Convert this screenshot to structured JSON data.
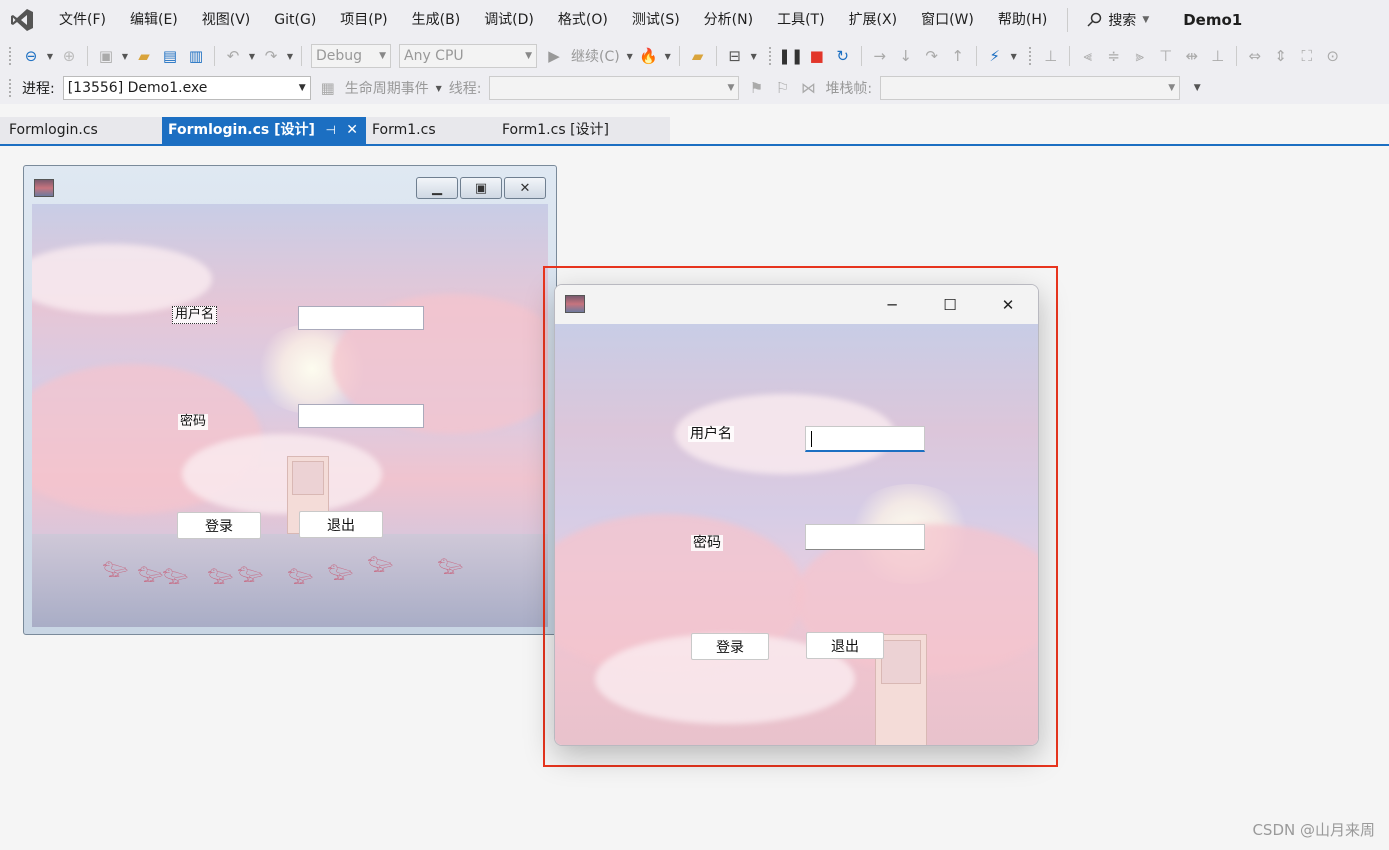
{
  "menubar": {
    "items": [
      "文件(F)",
      "编辑(E)",
      "视图(V)",
      "Git(G)",
      "项目(P)",
      "生成(B)",
      "调试(D)",
      "格式(O)",
      "测试(S)",
      "分析(N)",
      "工具(T)",
      "扩展(X)",
      "窗口(W)",
      "帮助(H)"
    ],
    "search_label": "搜索",
    "solution_name": "Demo1"
  },
  "toolbar": {
    "config": "Debug",
    "platform": "Any CPU",
    "continue_label": "继续(C)",
    "process_label": "进程:",
    "process_value": "[13556] Demo1.exe",
    "lifecycle_label": "生命周期事件",
    "thread_label": "线程:",
    "stackframe_label": "堆栈帧:"
  },
  "tabs": [
    {
      "label": "Formlogin.cs",
      "active": false
    },
    {
      "label": "Formlogin.cs [设计]",
      "active": true
    },
    {
      "label": "Form1.cs",
      "active": false
    },
    {
      "label": "Form1.cs [设计]",
      "active": false
    }
  ],
  "designer_form": {
    "username_label": "用户名",
    "password_label": "密码",
    "login_button": "登录",
    "exit_button": "退出"
  },
  "running_form": {
    "username_label": "用户名",
    "password_label": "密码",
    "login_button": "登录",
    "exit_button": "退出"
  },
  "watermark": "CSDN @山月来周",
  "colors": {
    "accent": "#1c6fc2",
    "highlight": "#e8351e"
  }
}
